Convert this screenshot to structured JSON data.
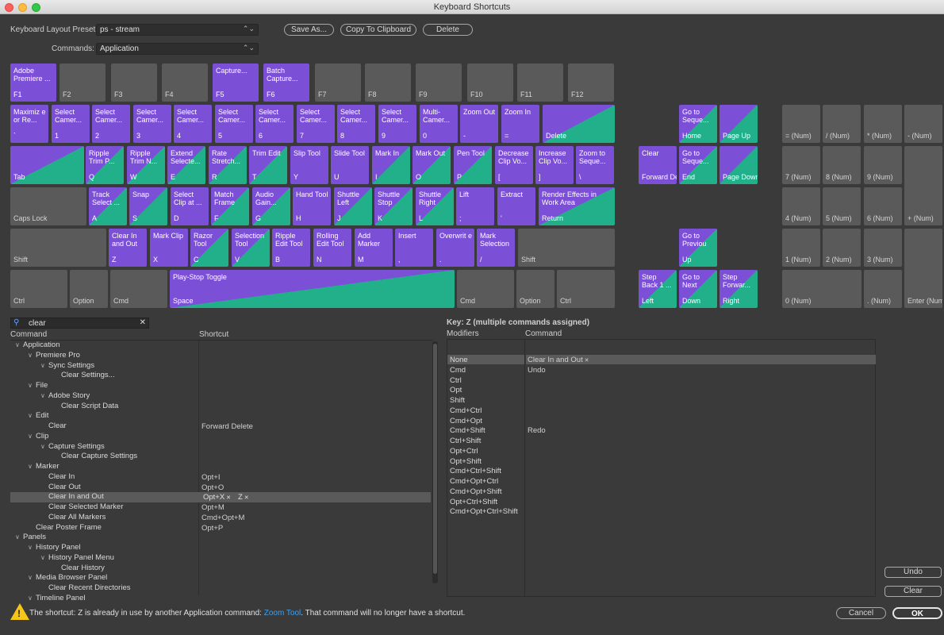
{
  "window": {
    "title": "Keyboard Shortcuts"
  },
  "colors": {
    "application": "#7b4fd6",
    "panel": "#22b08a",
    "unassigned": "#5a5a5a"
  },
  "header": {
    "preset_label": "Keyboard Layout Preset:",
    "preset_value": "ps - stream",
    "commands_label": "Commands:",
    "commands_value": "Application",
    "save_as": "Save As...",
    "copy": "Copy To Clipboard",
    "delete": "Delete"
  },
  "keys": [
    {
      "c": "Adobe Premiere ...",
      "l": "F1",
      "t": "app"
    },
    {
      "c": "",
      "l": "F2",
      "t": "gray"
    },
    {
      "c": "",
      "l": "F3",
      "t": "gray"
    },
    {
      "c": "",
      "l": "F4",
      "t": "gray"
    },
    {
      "c": "Capture...",
      "l": "F5",
      "t": "app"
    },
    {
      "c": "Batch Capture...",
      "l": "F6",
      "t": "app"
    },
    {
      "c": "",
      "l": "F7",
      "t": "gray"
    },
    {
      "c": "",
      "l": "F8",
      "t": "gray"
    },
    {
      "c": "",
      "l": "F9",
      "t": "gray"
    },
    {
      "c": "",
      "l": "F10",
      "t": "gray"
    },
    {
      "c": "",
      "l": "F11",
      "t": "gray"
    },
    {
      "c": "",
      "l": "F12",
      "t": "gray"
    },
    {
      "c": "Maximiz e or Re...",
      "l": "`",
      "t": "app"
    },
    {
      "c": "Select Camer...",
      "l": "1",
      "t": "app"
    },
    {
      "c": "Select Camer...",
      "l": "2",
      "t": "app"
    },
    {
      "c": "Select Camer...",
      "l": "3",
      "t": "app"
    },
    {
      "c": "Select Camer...",
      "l": "4",
      "t": "app"
    },
    {
      "c": "Select Camer...",
      "l": "5",
      "t": "app"
    },
    {
      "c": "Select Camer...",
      "l": "6",
      "t": "app"
    },
    {
      "c": "Select Camer...",
      "l": "7",
      "t": "app"
    },
    {
      "c": "Select Camer...",
      "l": "8",
      "t": "app"
    },
    {
      "c": "Select Camer...",
      "l": "9",
      "t": "app"
    },
    {
      "c": "Multi-Camer...",
      "l": "0",
      "t": "app"
    },
    {
      "c": "Zoom Out",
      "l": "-",
      "t": "app"
    },
    {
      "c": "Zoom In",
      "l": "=",
      "t": "app"
    },
    {
      "c": "",
      "l": "Delete",
      "t": "both"
    },
    {
      "c": "",
      "l": "Tab",
      "t": "both"
    },
    {
      "c": "Ripple Trim P...",
      "l": "Q",
      "t": "both"
    },
    {
      "c": "Ripple Trim N...",
      "l": "W",
      "t": "both"
    },
    {
      "c": "Extend Selecte...",
      "l": "E",
      "t": "both"
    },
    {
      "c": "Rate Stretch...",
      "l": "R",
      "t": "both"
    },
    {
      "c": "Trim Edit",
      "l": "T",
      "t": "both"
    },
    {
      "c": "Slip Tool",
      "l": "Y",
      "t": "app"
    },
    {
      "c": "Slide Tool",
      "l": "U",
      "t": "app"
    },
    {
      "c": "Mark In",
      "l": "I",
      "t": "both"
    },
    {
      "c": "Mark Out",
      "l": "O",
      "t": "both"
    },
    {
      "c": "Pen Tool",
      "l": "P",
      "t": "both"
    },
    {
      "c": "Decrease Clip Vo...",
      "l": "[",
      "t": "app"
    },
    {
      "c": "Increase Clip Vo...",
      "l": "]",
      "t": "app"
    },
    {
      "c": "Zoom to Seque...",
      "l": "\\",
      "t": "app"
    },
    {
      "c": "",
      "l": "Caps Lock",
      "t": "gray"
    },
    {
      "c": "Track Select ...",
      "l": "A",
      "t": "both"
    },
    {
      "c": "Snap",
      "l": "S",
      "t": "both"
    },
    {
      "c": "Select Clip at ...",
      "l": "D",
      "t": "app"
    },
    {
      "c": "Match Frame",
      "l": "F",
      "t": "both"
    },
    {
      "c": "Audio Gain...",
      "l": "G",
      "t": "both"
    },
    {
      "c": "Hand Tool",
      "l": "H",
      "t": "app"
    },
    {
      "c": "Shuttle Left",
      "l": "J",
      "t": "both"
    },
    {
      "c": "Shuttle Stop",
      "l": "K",
      "t": "both"
    },
    {
      "c": "Shuttle Right",
      "l": "L",
      "t": "both"
    },
    {
      "c": "Lift",
      "l": ";",
      "t": "app"
    },
    {
      "c": "Extract",
      "l": "'",
      "t": "app"
    },
    {
      "c": "Render Effects in Work Area",
      "l": "Return",
      "t": "both"
    },
    {
      "c": "",
      "l": "Shift",
      "t": "gray"
    },
    {
      "c": "Clear In and Out",
      "l": "Z",
      "t": "app"
    },
    {
      "c": "Mark Clip",
      "l": "X",
      "t": "app"
    },
    {
      "c": "Razor Tool",
      "l": "C",
      "t": "both"
    },
    {
      "c": "Selection Tool",
      "l": "V",
      "t": "both"
    },
    {
      "c": "Ripple Edit Tool",
      "l": "B",
      "t": "app"
    },
    {
      "c": "Rolling Edit Tool",
      "l": "N",
      "t": "app"
    },
    {
      "c": "Add Marker",
      "l": "M",
      "t": "app"
    },
    {
      "c": "Insert",
      "l": ",",
      "t": "app"
    },
    {
      "c": "Overwrit e",
      "l": ".",
      "t": "app"
    },
    {
      "c": "Mark Selection",
      "l": "/",
      "t": "app"
    },
    {
      "c": "",
      "l": "Shift",
      "t": "gray"
    },
    {
      "c": "",
      "l": "Ctrl",
      "t": "gray"
    },
    {
      "c": "",
      "l": "Option",
      "t": "gray"
    },
    {
      "c": "",
      "l": "Cmd",
      "t": "gray"
    },
    {
      "c": "Play-Stop Toggle",
      "l": "Space",
      "t": "both-t"
    },
    {
      "c": "",
      "l": "Cmd",
      "t": "gray"
    },
    {
      "c": "",
      "l": "Option",
      "t": "gray"
    },
    {
      "c": "",
      "l": "Ctrl",
      "t": "gray"
    },
    {
      "c": "Go to Seque...",
      "l": "Home",
      "t": "both"
    },
    {
      "c": "",
      "l": "Page Up",
      "t": "both"
    },
    {
      "c": "Clear",
      "l": "Forward Delete",
      "t": "app"
    },
    {
      "c": "Go to Seque...",
      "l": "End",
      "t": "both"
    },
    {
      "c": "",
      "l": "Page Down",
      "t": "both"
    },
    {
      "c": "Go to Previou",
      "l": "Up",
      "t": "both"
    },
    {
      "c": "Step Back 1 ...",
      "l": "Left",
      "t": "both"
    },
    {
      "c": "Go to Next",
      "l": "Down",
      "t": "both"
    },
    {
      "c": "Step Forwar...",
      "l": "Right",
      "t": "both"
    },
    {
      "c": "",
      "l": "= (Num)",
      "t": "gray"
    },
    {
      "c": "",
      "l": "/ (Num)",
      "t": "gray"
    },
    {
      "c": "",
      "l": "* (Num)",
      "t": "gray"
    },
    {
      "c": "",
      "l": "- (Num)",
      "t": "gray"
    },
    {
      "c": "",
      "l": "7 (Num)",
      "t": "gray"
    },
    {
      "c": "",
      "l": "8 (Num)",
      "t": "gray"
    },
    {
      "c": "",
      "l": "9 (Num)",
      "t": "gray"
    },
    {
      "c": "",
      "l": "+ (Num)",
      "t": "gray"
    },
    {
      "c": "",
      "l": "4 (Num)",
      "t": "gray"
    },
    {
      "c": "",
      "l": "5 (Num)",
      "t": "gray"
    },
    {
      "c": "",
      "l": "6 (Num)",
      "t": "gray"
    },
    {
      "c": "",
      "l": "1 (Num)",
      "t": "gray"
    },
    {
      "c": "",
      "l": "2 (Num)",
      "t": "gray"
    },
    {
      "c": "",
      "l": "3 (Num)",
      "t": "gray"
    },
    {
      "c": "",
      "l": "Enter (Num)",
      "t": "gray"
    },
    {
      "c": "",
      "l": "0 (Num)",
      "t": "gray"
    },
    {
      "c": "",
      "l": ". (Num)",
      "t": "gray"
    }
  ],
  "search": {
    "value": "clear"
  },
  "commands_panel": {
    "col_command": "Command",
    "col_shortcut": "Shortcut",
    "rows": [
      {
        "t": "Application",
        "d": 0,
        "x": true,
        "s": ""
      },
      {
        "t": "Premiere Pro",
        "d": 1,
        "x": true,
        "s": ""
      },
      {
        "t": "Sync Settings",
        "d": 2,
        "x": true,
        "s": ""
      },
      {
        "t": "Clear Settings...",
        "d": 3,
        "x": false,
        "s": ""
      },
      {
        "t": "File",
        "d": 1,
        "x": true,
        "s": ""
      },
      {
        "t": "Adobe Story",
        "d": 2,
        "x": true,
        "s": ""
      },
      {
        "t": "Clear Script Data",
        "d": 3,
        "x": false,
        "s": ""
      },
      {
        "t": "Edit",
        "d": 1,
        "x": true,
        "s": ""
      },
      {
        "t": "Clear",
        "d": 2,
        "x": false,
        "s": "Forward Delete"
      },
      {
        "t": "Clip",
        "d": 1,
        "x": true,
        "s": ""
      },
      {
        "t": "Capture Settings",
        "d": 2,
        "x": true,
        "s": ""
      },
      {
        "t": "Clear Capture Settings",
        "d": 3,
        "x": false,
        "s": ""
      },
      {
        "t": "Marker",
        "d": 1,
        "x": true,
        "s": ""
      },
      {
        "t": "Clear In",
        "d": 2,
        "x": false,
        "s": "Opt+I"
      },
      {
        "t": "Clear Out",
        "d": 2,
        "x": false,
        "s": "Opt+O"
      },
      {
        "t": "Clear In and Out",
        "d": 2,
        "x": false,
        "s": "",
        "sel": true
      },
      {
        "t": "Clear Selected Marker",
        "d": 2,
        "x": false,
        "s": "Opt+M"
      },
      {
        "t": "Clear All Markers",
        "d": 2,
        "x": false,
        "s": "Cmd+Opt+M"
      },
      {
        "t": "Clear Poster Frame",
        "d": 1,
        "x": false,
        "s": "Opt+P"
      },
      {
        "t": "Panels",
        "d": 0,
        "x": true,
        "s": ""
      },
      {
        "t": "History Panel",
        "d": 1,
        "x": true,
        "s": ""
      },
      {
        "t": "History Panel Menu",
        "d": 2,
        "x": true,
        "s": ""
      },
      {
        "t": "Clear History",
        "d": 3,
        "x": false,
        "s": ""
      },
      {
        "t": "Media Browser Panel",
        "d": 1,
        "x": true,
        "s": ""
      },
      {
        "t": "Clear Recent Directories",
        "d": 2,
        "x": false,
        "s": ""
      },
      {
        "t": "Timeline Panel",
        "d": 1,
        "x": true,
        "s": ""
      }
    ],
    "selected_chips": [
      "Opt+X",
      "Z"
    ]
  },
  "key_panel": {
    "title": "Key:  Z (multiple commands assigned)",
    "col_modifiers": "Modifiers",
    "col_command": "Command",
    "modifiers": [
      "None",
      "Cmd",
      "Ctrl",
      "Opt",
      "Shift",
      "Cmd+Ctrl",
      "Cmd+Opt",
      "Cmd+Shift",
      "Ctrl+Shift",
      "Opt+Ctrl",
      "Opt+Shift",
      "Cmd+Ctrl+Shift",
      "Cmd+Opt+Ctrl",
      "Cmd+Opt+Shift",
      "Opt+Ctrl+Shift",
      "Cmd+Opt+Ctrl+Shift"
    ],
    "commands": {
      "0": "Clear In and Out",
      "1": "Undo",
      "7": "Redo"
    }
  },
  "side_buttons": {
    "undo": "Undo",
    "clear": "Clear"
  },
  "footer": {
    "warning_pre": "The shortcut: Z is already in use by another Application command: ",
    "warning_link": "Zoom Tool",
    "warning_post": ". That command will no longer have a shortcut.",
    "cancel": "Cancel",
    "ok": "OK"
  }
}
